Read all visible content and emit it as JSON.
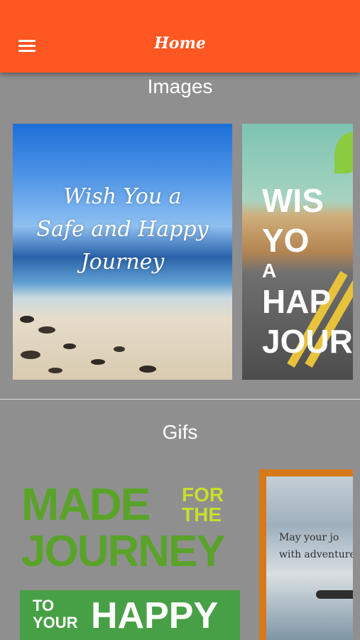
{
  "appbar": {
    "title": "Home",
    "menu_icon": "hamburger-menu-icon",
    "color": "#ff5722"
  },
  "sections": {
    "images": {
      "title": "Images",
      "cards": [
        {
          "text_lines": [
            "Wish You a",
            "Safe and Happy",
            "Journey"
          ]
        },
        {
          "text_lines": [
            "WIS",
            "YO",
            "A",
            "HAP",
            "JOUR"
          ]
        }
      ]
    },
    "gifs": {
      "title": "Gifs",
      "cards": [
        {
          "text": {
            "line1": "MADE",
            "for": "FOR",
            "the": "THE",
            "line2": "JOURNEY",
            "to": "TO",
            "your": "YOUR",
            "happy": "HAPPY"
          }
        },
        {
          "text_lines": [
            "May your jo",
            "with adventure"
          ]
        }
      ]
    }
  }
}
